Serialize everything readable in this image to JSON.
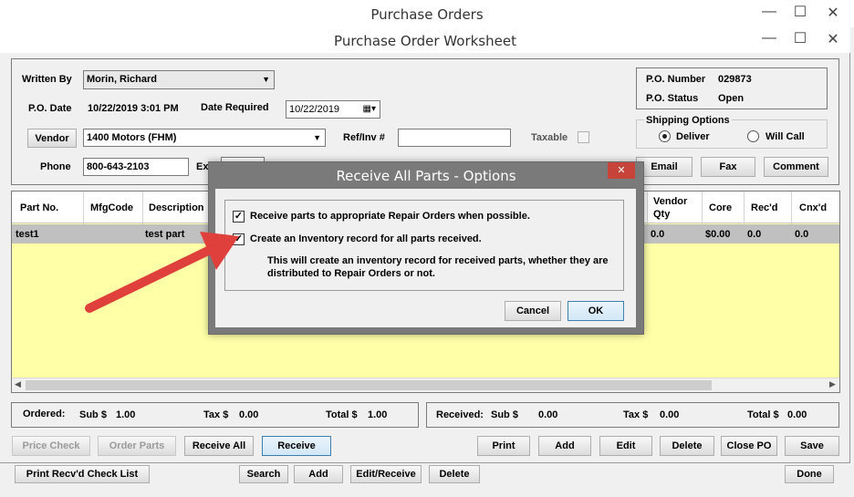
{
  "outer_title": "Purchase Orders",
  "inner_title": "Purchase Order Worksheet",
  "header": {
    "written_by_label": "Written By",
    "written_by_value": "Morin, Richard",
    "po_date_label": "P.O. Date",
    "po_date_value": "10/22/2019 3:01 PM",
    "date_required_label": "Date Required",
    "date_required_value": "10/22/2019",
    "vendor_button": "Vendor",
    "vendor_value": "1400 Motors (FHM)",
    "refinv_label": "Ref/Inv #",
    "refinv_value": "",
    "taxable_label": "Taxable",
    "phone_label": "Phone",
    "phone_value": "800-643-2103",
    "ext_label": "Ex",
    "po_number_label": "P.O. Number",
    "po_number_value": "029873",
    "po_status_label": "P.O. Status",
    "po_status_value": "Open",
    "shipping_label": "Shipping Options",
    "deliver_label": "Deliver",
    "willcall_label": "Will Call",
    "email_button": "Email",
    "fax_button": "Fax",
    "comment_button": "Comment"
  },
  "table": {
    "columns": [
      "Part No.",
      "MfgCode",
      "Description",
      "Vendor Qty",
      "Core",
      "Rec'd",
      "Cnx'd"
    ],
    "vendor_qty_line1": "Vendor",
    "vendor_qty_line2": "Qty",
    "rows": [
      {
        "part_no": "test1",
        "mfg_code": "",
        "description": "test part",
        "vendor_qty": "0.0",
        "core": "$0.00",
        "recd": "0.0",
        "cnxd": "0.0"
      }
    ]
  },
  "totals": {
    "ordered_label": "Ordered:",
    "ordered_sub_label": "Sub $",
    "ordered_sub": "1.00",
    "ordered_tax_label": "Tax $",
    "ordered_tax": "0.00",
    "ordered_total_label": "Total $",
    "ordered_total": "1.00",
    "received_label": "Received:",
    "received_sub_label": "Sub $",
    "received_sub": "0.00",
    "received_tax_label": "Tax $",
    "received_tax": "0.00",
    "received_total_label": "Total $",
    "received_total": "0.00"
  },
  "buttons": {
    "price_check": "Price Check",
    "order_parts": "Order Parts",
    "receive_all": "Receive All",
    "receive": "Receive",
    "print": "Print",
    "add": "Add",
    "edit": "Edit",
    "delete": "Delete",
    "close_po": "Close PO",
    "save": "Save"
  },
  "background_buttons": {
    "print_recvd": "Print Recv'd Check List",
    "search": "Search",
    "add": "Add",
    "edit_receive": "Edit/Receive",
    "delete": "Delete",
    "done": "Done"
  },
  "dialog": {
    "title": "Receive All Parts - Options",
    "option1": "Receive parts to appropriate Repair Orders when possible.",
    "option2": "Create an Inventory record for all parts received.",
    "note": "This will create an inventory record for received parts, whether they are distributed to Repair Orders or not.",
    "cancel": "Cancel",
    "ok": "OK",
    "close_glyph": "✕"
  },
  "colors": {
    "grid_background": "#ffffa8",
    "selected_row": "#c0c0c0",
    "dialog_close": "#c7443b",
    "arrow": "#e0403c"
  }
}
